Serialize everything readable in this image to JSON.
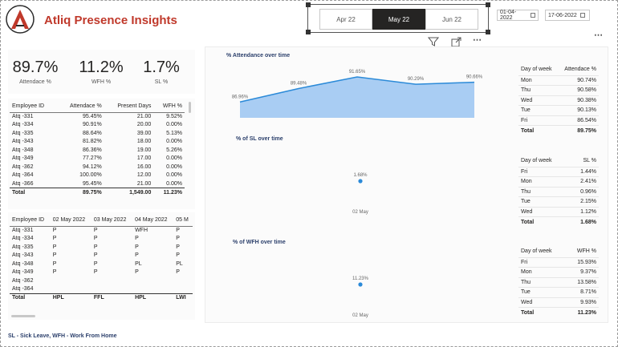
{
  "app": {
    "title": "Atliq Presence Insights",
    "accent": "#c0392b"
  },
  "slicer": {
    "months": [
      "Apr 22",
      "May 22",
      "Jun 22"
    ],
    "selected": "May 22"
  },
  "date_range": {
    "start": "01-04-2022",
    "end": "17-06-2022"
  },
  "kpis": [
    {
      "value": "89.7%",
      "label": "Attendace %"
    },
    {
      "value": "11.2%",
      "label": "WFH %"
    },
    {
      "value": "1.7%",
      "label": "SL %"
    }
  ],
  "emp_table": {
    "headers": [
      "Employee ID",
      "Attendace %",
      "Present Days",
      "WFH %"
    ],
    "rows": [
      [
        "Atq -331",
        "95.45%",
        "21.00",
        "9.52%"
      ],
      [
        "Atq -334",
        "90.91%",
        "20.00",
        "0.00%"
      ],
      [
        "Atq -335",
        "88.64%",
        "39.00",
        "5.13%"
      ],
      [
        "Atq -343",
        "81.82%",
        "18.00",
        "0.00%"
      ],
      [
        "Atq -348",
        "86.36%",
        "19.00",
        "5.26%"
      ],
      [
        "Atq -349",
        "77.27%",
        "17.00",
        "0.00%"
      ],
      [
        "Atq -362",
        "94.12%",
        "16.00",
        "0.00%"
      ],
      [
        "Atq -364",
        "100.00%",
        "12.00",
        "0.00%"
      ],
      [
        "Atq -366",
        "95.45%",
        "21.00",
        "0.00%"
      ]
    ],
    "total": [
      "Total",
      "89.75%",
      "1,549.00",
      "11.23%"
    ]
  },
  "daily_table": {
    "headers": [
      "Employee ID",
      "02 May 2022",
      "03 May 2022",
      "04 May 2022",
      "05 M"
    ],
    "rows": [
      [
        "Atq -331",
        "P",
        "P",
        "WFH",
        "P"
      ],
      [
        "Atq -334",
        "P",
        "P",
        "P",
        "P"
      ],
      [
        "Atq -335",
        "P",
        "P",
        "P",
        "P"
      ],
      [
        "Atq -343",
        "P",
        "P",
        "P",
        "P"
      ],
      [
        "Atq -348",
        "P",
        "P",
        "PL",
        "PL"
      ],
      [
        "Atq -349",
        "P",
        "P",
        "P",
        "P"
      ],
      [
        "Atq -362",
        "",
        "",
        "",
        ""
      ],
      [
        "Atq -364",
        "",
        "",
        "",
        ""
      ]
    ],
    "total": [
      "Total",
      "HPL",
      "FFL",
      "HPL",
      "LWI"
    ]
  },
  "chart_data": [
    {
      "type": "area",
      "title": "% Attendance  over time",
      "categories": [
        "",
        "",
        "",
        "",
        ""
      ],
      "values": [
        86.96,
        89.48,
        91.65,
        90.29,
        90.66
      ],
      "data_labels": [
        "86.96%",
        "89.48%",
        "91.65%",
        "90.29%",
        "90.66%"
      ],
      "ylim": [
        84,
        93
      ],
      "color": "#2b8ad8",
      "fill": "#a9cdf3"
    },
    {
      "type": "scatter",
      "title": "% of SL  over time",
      "categories": [
        "02 May"
      ],
      "values": [
        1.68
      ],
      "data_labels": [
        "1.68%"
      ],
      "color": "#2b8ad8"
    },
    {
      "type": "scatter",
      "title": "% of WFH over time",
      "categories": [
        "02 May"
      ],
      "values": [
        11.23
      ],
      "data_labels": [
        "11.23%"
      ],
      "color": "#2b8ad8"
    }
  ],
  "dow_attendance": {
    "headers": [
      "Day of week",
      "Attendace %"
    ],
    "rows": [
      [
        "Mon",
        "90.74%"
      ],
      [
        "Thu",
        "90.58%"
      ],
      [
        "Wed",
        "90.38%"
      ],
      [
        "Tue",
        "90.13%"
      ],
      [
        "Fri",
        "86.54%"
      ]
    ],
    "total": [
      "Total",
      "89.75%"
    ]
  },
  "dow_sl": {
    "headers": [
      "Day of week",
      "SL %"
    ],
    "rows": [
      [
        "Fri",
        "1.44%"
      ],
      [
        "Mon",
        "2.41%"
      ],
      [
        "Thu",
        "0.96%"
      ],
      [
        "Tue",
        "2.15%"
      ],
      [
        "Wed",
        "1.12%"
      ]
    ],
    "total": [
      "Total",
      "1.68%"
    ]
  },
  "dow_wfh": {
    "headers": [
      "Day of week",
      "WFH %"
    ],
    "rows": [
      [
        "Fri",
        "15.93%"
      ],
      [
        "Mon",
        "9.37%"
      ],
      [
        "Thu",
        "13.58%"
      ],
      [
        "Tue",
        "8.71%"
      ],
      [
        "Wed",
        "9.93%"
      ]
    ],
    "total": [
      "Total",
      "11.23%"
    ]
  },
  "footnote": "SL - Sick Leave, WFH - Work From Home",
  "icons": {
    "filter": "filter-icon",
    "focus": "focus-mode-icon",
    "more": "more-options-icon"
  }
}
